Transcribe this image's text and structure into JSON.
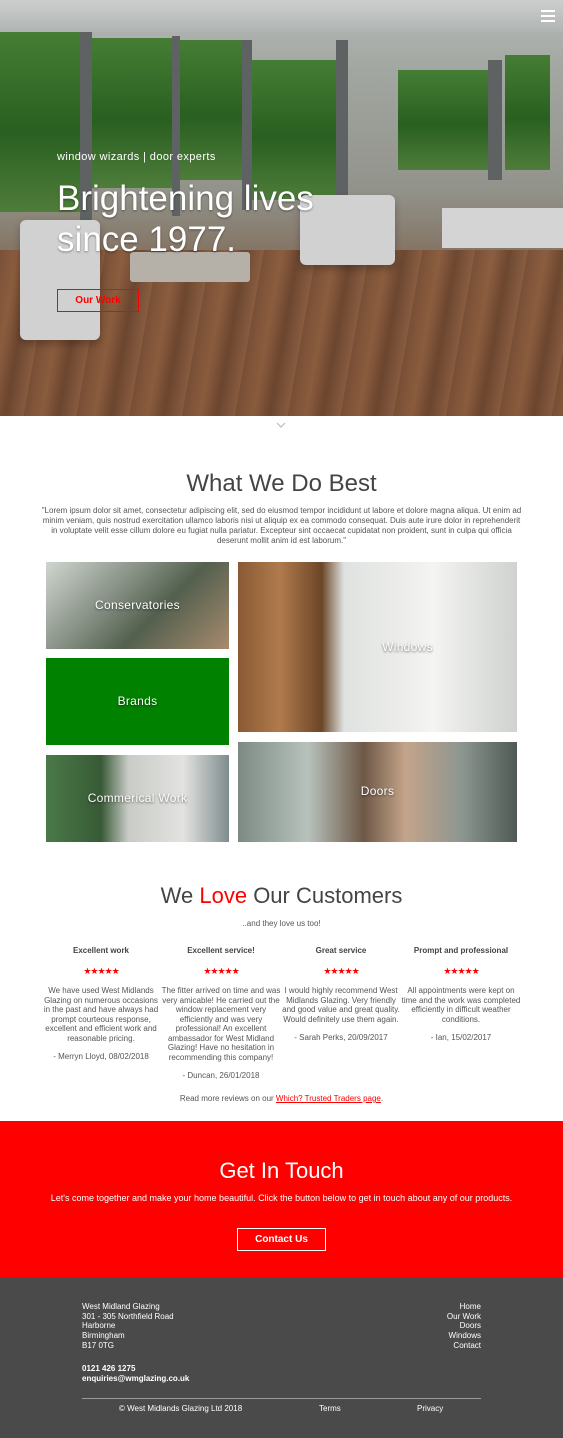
{
  "hero": {
    "tagline": "window wizards | door experts",
    "headline_line1": "Brightening lives",
    "headline_line2": "since 1977.",
    "cta_label": "Our Work"
  },
  "what_we_do": {
    "title": "What We Do Best",
    "intro": "\"Lorem ipsum dolor sit amet, consectetur adipiscing elit, sed do eiusmod tempor incididunt ut labore et dolore magna aliqua. Ut enim ad minim veniam, quis nostrud exercitation ullamco laboris nisi ut aliquip ex ea commodo consequat. Duis aute irure dolor in reprehenderit in voluptate velit esse cillum dolore eu fugiat nulla pariatur. Excepteur sint occaecat cupidatat non proident, sunt in culpa qui officia deserunt mollit anim id est laborum.\"",
    "tiles": {
      "conservatories": "Conservatories",
      "brands": "Brands",
      "commercial": "Commerical Work",
      "windows": "Windows",
      "doors": "Doors"
    }
  },
  "customers": {
    "title_pre": "We ",
    "title_love": "Love",
    "title_post": " Our Customers",
    "subtitle": "..and they love us too!",
    "reviews": [
      {
        "title": "Excellent work",
        "stars": "★★★★★",
        "body": "We have used West Midlands Glazing on numerous occasions in the past and have always had prompt courteous response, excellent and efficient work and reasonable pricing.",
        "author": "- Merryn Lloyd, 08/02/2018"
      },
      {
        "title": "Excellent service!",
        "stars": "★★★★★",
        "body": "The fitter arrived on time and was very amicable! He carried out the window replacement very efficiently and was very professional! An excellent ambassador for West Midland Glazing! Have no hesitation in recommending this company!",
        "author": "- Duncan, 26/01/2018"
      },
      {
        "title": "Great service",
        "stars": "★★★★★",
        "body": "I would highly recommend West Midlands Glazing. Very friendly and good value and great quality. Would definitely use them again.",
        "author": "- Sarah Perks, 20/09/2017"
      },
      {
        "title": "Prompt and professional",
        "stars": "★★★★★",
        "body": "All appointments were kept on time and the work was completed efficiently in difficult weather conditions.",
        "author": "- Ian, 15/02/2017"
      }
    ],
    "more_prefix": "Read more reviews on our ",
    "more_link": "Which? Trusted Traders page",
    "more_suffix": "."
  },
  "get_in_touch": {
    "title": "Get In Touch",
    "text": "Let's come together and make your home beautiful. Click the button below to get in touch about any of our products.",
    "button": "Contact Us"
  },
  "footer": {
    "address": [
      "West Midland Glazing",
      "301 - 305 Northfield Road",
      "Harborne",
      "Birmingham",
      "B17 0TG"
    ],
    "phone": "0121 426 1275",
    "email": "enquiries@wmglazing.co.uk",
    "links": [
      "Home",
      "Our Work",
      "Doors",
      "Windows",
      "Contact"
    ],
    "copyright": "© West Midlands Glazing Ltd 2018",
    "terms": "Terms",
    "privacy": "Privacy"
  },
  "colors": {
    "accent": "#ff0000",
    "brands_tile": "#008200",
    "footer_bg": "#4a4a4a"
  },
  "icons": [
    "hamburger-menu-icon",
    "chevron-down-icon",
    "star-icon"
  ]
}
